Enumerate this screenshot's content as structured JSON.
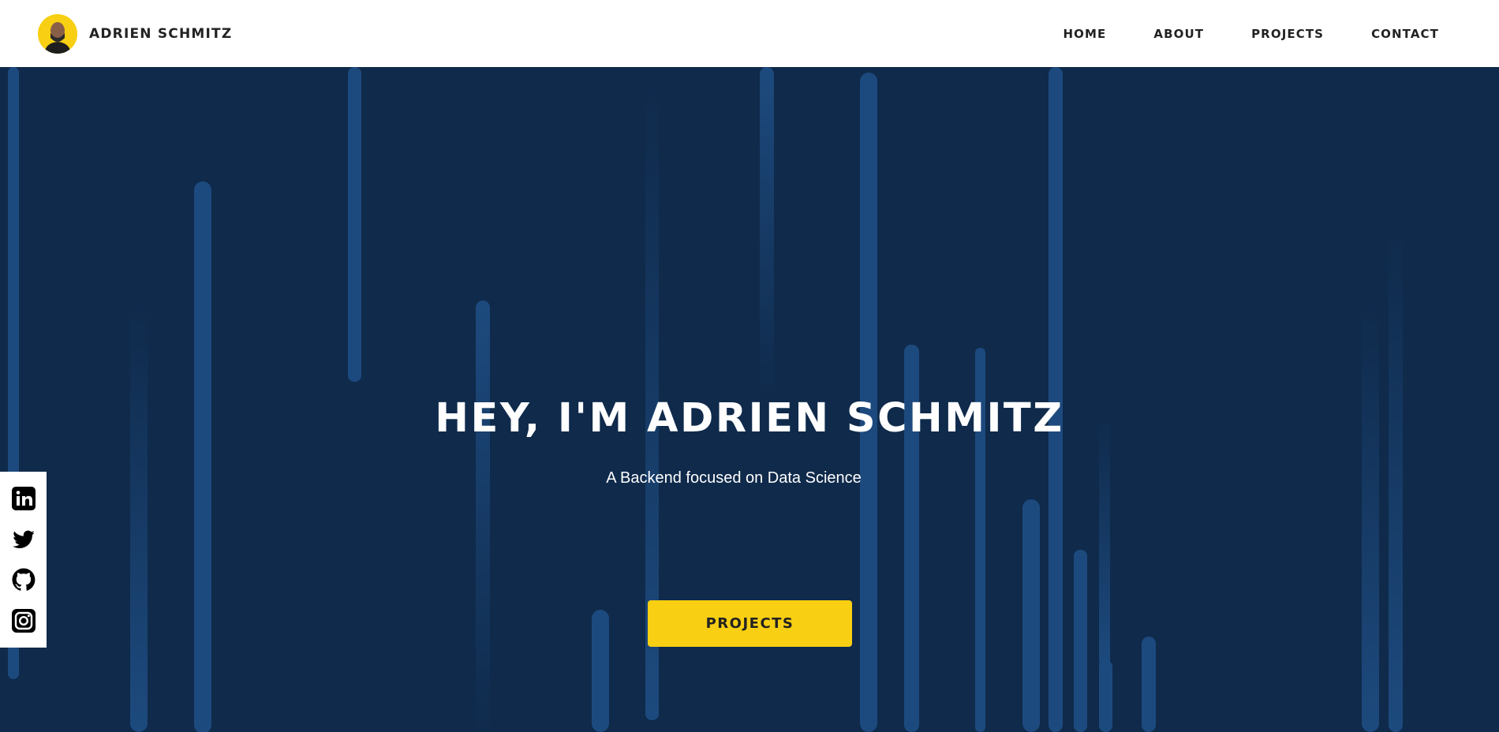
{
  "header": {
    "brand_name": "ADRIEN SCHMITZ",
    "nav": [
      {
        "label": "HOME"
      },
      {
        "label": "ABOUT"
      },
      {
        "label": "PROJECTS"
      },
      {
        "label": "CONTACT"
      }
    ]
  },
  "hero": {
    "title": "HEY, I'M ADRIEN SCHMITZ",
    "subtitle": "A Backend focused on Data Science",
    "button_label": "PROJECTS"
  },
  "social": [
    {
      "icon": "linkedin-icon"
    },
    {
      "icon": "twitter-icon"
    },
    {
      "icon": "github-icon"
    },
    {
      "icon": "instagram-icon"
    }
  ],
  "colors": {
    "background": "#0f2a4b",
    "accent": "#f8cf12",
    "bar": "#1d4a7e",
    "header_bg": "#ffffff"
  }
}
